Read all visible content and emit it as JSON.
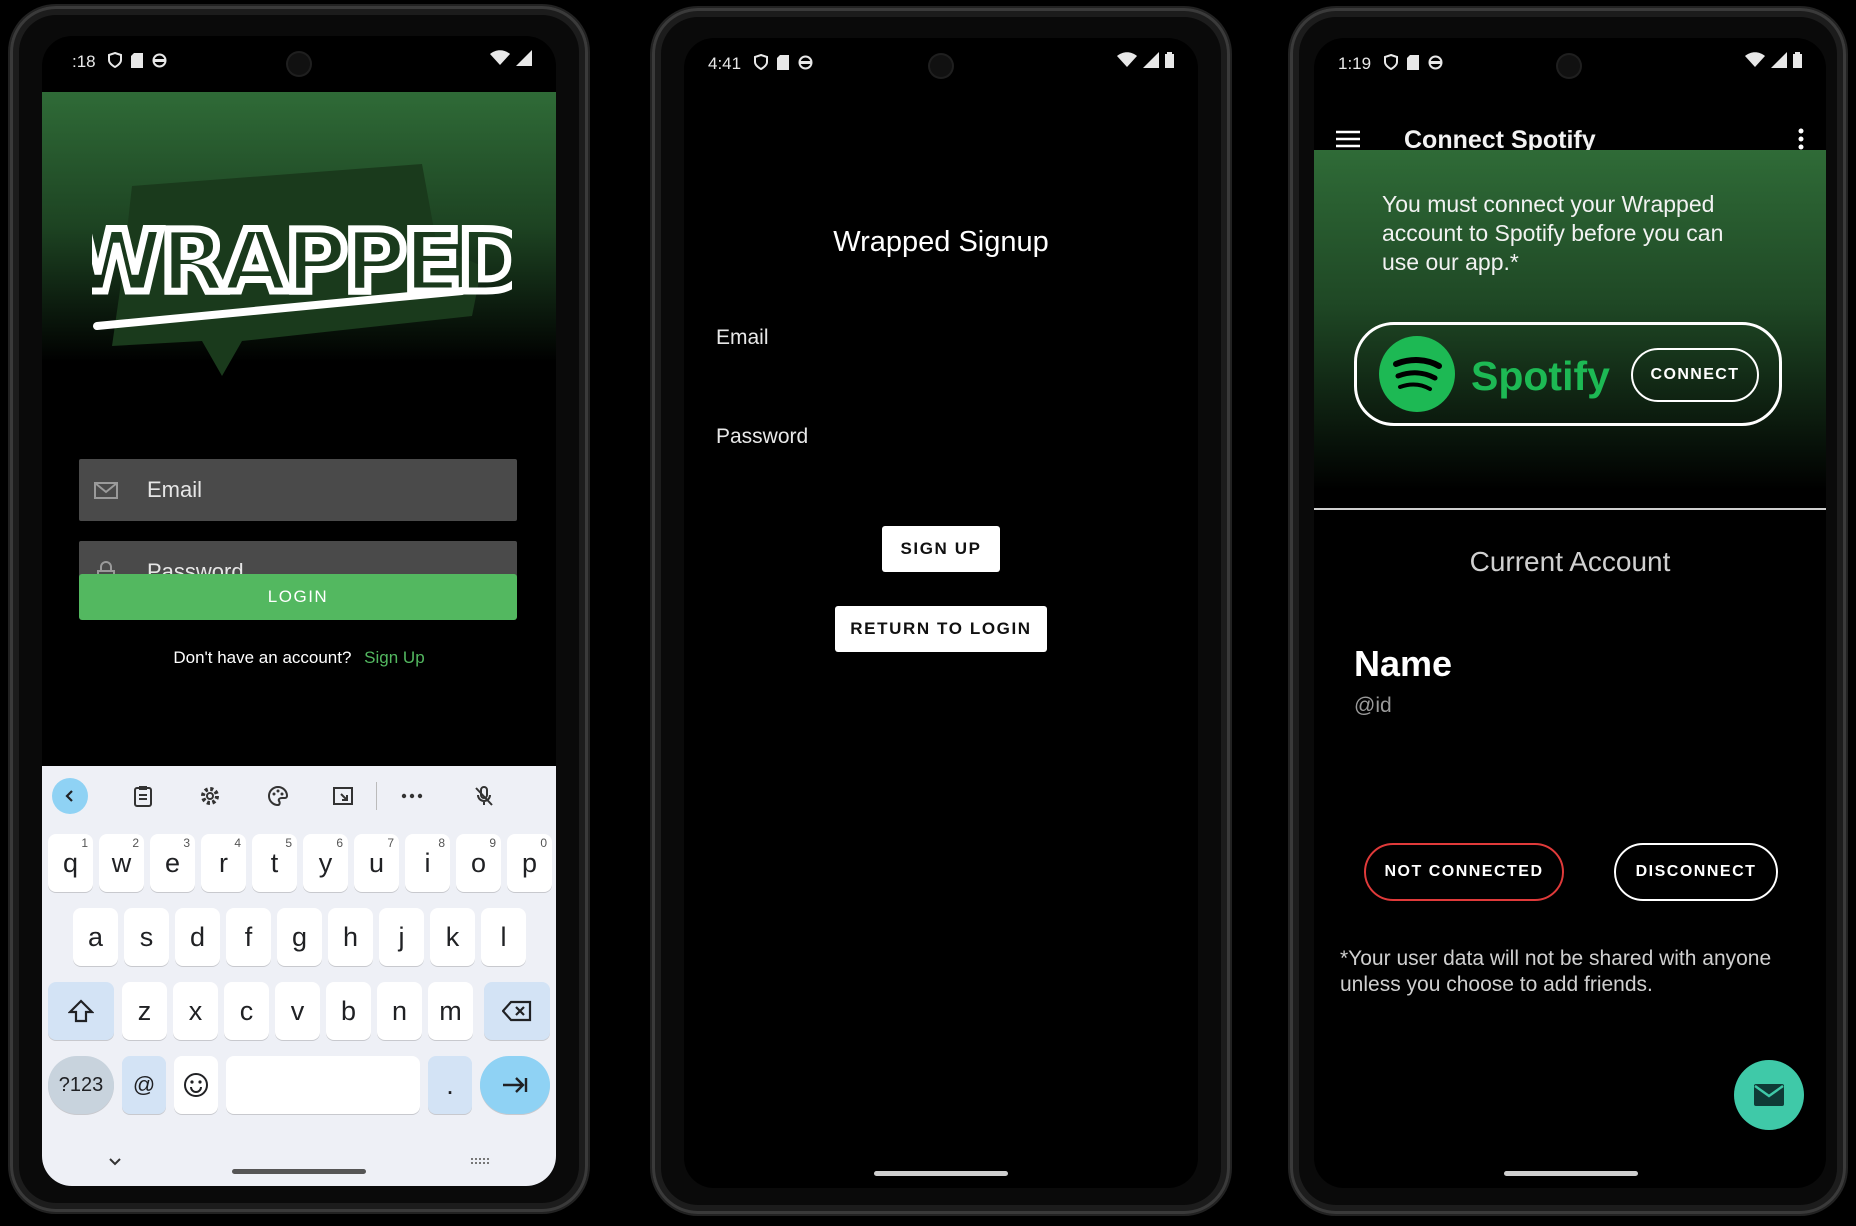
{
  "colors": {
    "accent_green": "#53b860",
    "spotify_green": "#1db954",
    "fab_teal": "#3fc9a8",
    "error_red": "#e03a3a"
  },
  "login_screen": {
    "status_time": ":18",
    "logo_text": "WRAPPED",
    "email_placeholder": "Email",
    "password_placeholder": "Password",
    "login_label": "LOGIN",
    "no_account_text": "Don't have an account?",
    "signup_link": "Sign Up",
    "keyboard": {
      "row1": [
        {
          "k": "q",
          "s": "1"
        },
        {
          "k": "w",
          "s": "2"
        },
        {
          "k": "e",
          "s": "3"
        },
        {
          "k": "r",
          "s": "4"
        },
        {
          "k": "t",
          "s": "5"
        },
        {
          "k": "y",
          "s": "6"
        },
        {
          "k": "u",
          "s": "7"
        },
        {
          "k": "i",
          "s": "8"
        },
        {
          "k": "o",
          "s": "9"
        },
        {
          "k": "p",
          "s": "0"
        }
      ],
      "row2": [
        "a",
        "s",
        "d",
        "f",
        "g",
        "h",
        "j",
        "k",
        "l"
      ],
      "row3": [
        "z",
        "x",
        "c",
        "v",
        "b",
        "n",
        "m"
      ],
      "symbols_key": "?123",
      "at_key": "@",
      "period_key": "."
    }
  },
  "signup_screen": {
    "status_time": "4:41",
    "title": "Wrapped Signup",
    "email_label": "Email",
    "password_label": "Password",
    "signup_button": "SIGN UP",
    "return_button": "RETURN TO LOGIN"
  },
  "connect_screen": {
    "status_time": "1:19",
    "app_title": "Connect Spotify",
    "message": "You must connect your Wrapped account to Spotify before you can use our app.*",
    "spotify_brand": "Spotify",
    "connect_button": "CONNECT",
    "current_account_heading": "Current Account",
    "account_name": "Name",
    "account_id": "@id",
    "status_button": "NOT CONNECTED",
    "disconnect_button": "DISCONNECT",
    "footnote": "*Your user data will not be shared with anyone unless you choose to add friends."
  }
}
